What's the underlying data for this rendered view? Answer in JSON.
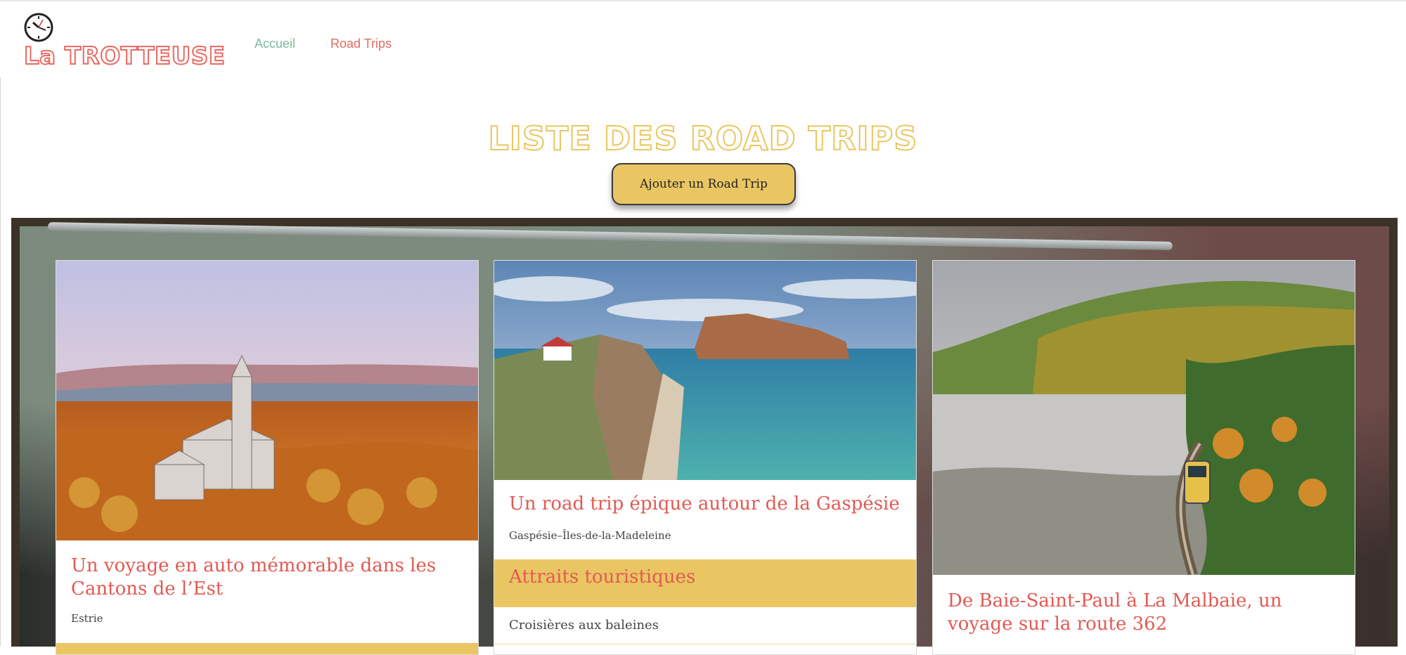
{
  "header": {
    "brand": {
      "pre": "La",
      "post": "TROTTEUSE"
    },
    "nav": {
      "home": "Accueil",
      "trips": "Road Trips"
    }
  },
  "main": {
    "title": "Liste des road trips",
    "add_button": "Ajouter un Road Trip"
  },
  "cards": [
    {
      "title": "Un voyage en auto mémorable dans les Cantons de l’Est",
      "region": "Estrie",
      "image": "autumn-church-landscape"
    },
    {
      "title": "Un road trip épique autour de la Gaspésie",
      "region": "Gaspésie–Îles-de-la-Madeleine",
      "section": "Attraits touristiques",
      "item": "Croisières aux baleines",
      "image": "perce-rock-seascape"
    },
    {
      "title": "De Baie-Saint-Paul à La Malbaie, un voyage sur la route 362",
      "image": "train-autumn-valley"
    }
  ],
  "colors": {
    "accent_red": "#e15a53",
    "accent_yellow": "#eac663",
    "nav_green": "#7db998"
  },
  "icons": {
    "logo": "clock-icon"
  }
}
